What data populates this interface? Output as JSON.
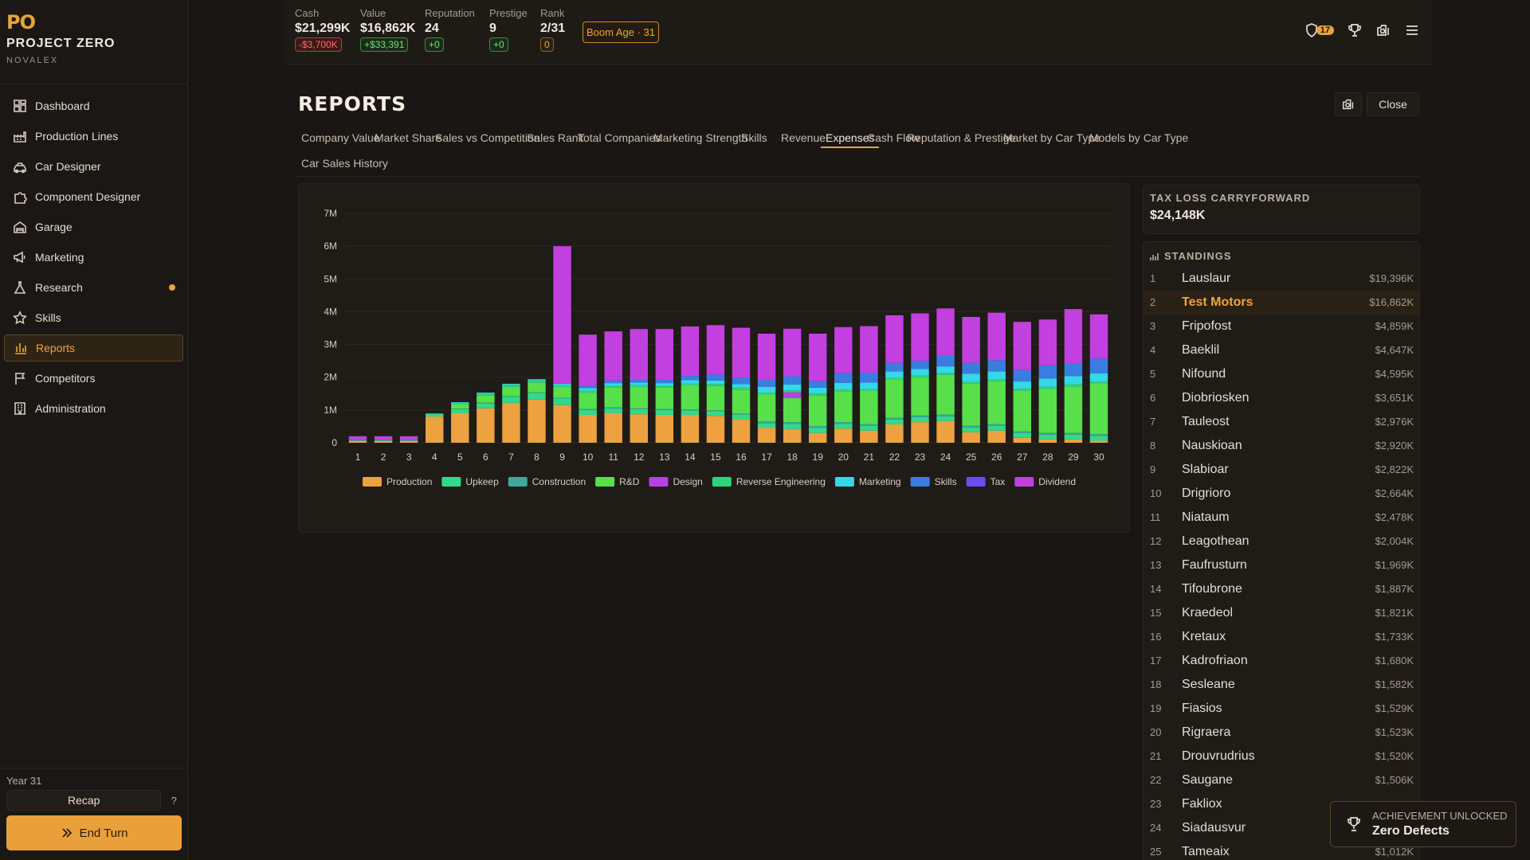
{
  "app": {
    "logo": "PO",
    "name": "PROJECT ZERO",
    "company": "NOVALEX"
  },
  "nav": [
    {
      "label": "Dashboard",
      "icon": "dashboard-icon"
    },
    {
      "label": "Production Lines",
      "icon": "factory-icon"
    },
    {
      "label": "Car Designer",
      "icon": "car-icon"
    },
    {
      "label": "Component Designer",
      "icon": "puzzle-icon"
    },
    {
      "label": "Garage",
      "icon": "garage-icon"
    },
    {
      "label": "Marketing",
      "icon": "megaphone-icon"
    },
    {
      "label": "Research",
      "icon": "flask-icon",
      "dot": true
    },
    {
      "label": "Skills",
      "icon": "star-icon"
    },
    {
      "label": "Reports",
      "icon": "bar-chart-icon",
      "active": true
    },
    {
      "label": "Competitors",
      "icon": "flag-icon"
    },
    {
      "label": "Administration",
      "icon": "building-icon"
    }
  ],
  "footer": {
    "year": "Year 31",
    "recap": "Recap",
    "help": "?",
    "end_turn": "End Turn"
  },
  "stats": {
    "cash": {
      "label": "Cash",
      "value": "$21,299K",
      "delta": "-$3,700K"
    },
    "value": {
      "label": "Value",
      "value": "$16,862K",
      "delta": "+$33,391"
    },
    "reputation": {
      "label": "Reputation",
      "value": "24",
      "delta": "+0"
    },
    "prestige": {
      "label": "Prestige",
      "value": "9",
      "delta": "+0"
    },
    "rank": {
      "label": "Rank",
      "value": "2/31",
      "delta": "0"
    },
    "boom": "Boom Age · 31",
    "notifications": "17"
  },
  "page": {
    "title": "REPORTS",
    "close": "Close"
  },
  "tabs": [
    "Company Value",
    "Market Share",
    "Sales vs Competition",
    "Sales Rank",
    "Total Companies",
    "Marketing Strength",
    "Skills",
    "Revenue",
    "Expenses",
    "Cash Flow",
    "Reputation & Prestige",
    "Market by Car Type",
    "Models by Car Type",
    "Car Sales History"
  ],
  "active_tab": "Expenses",
  "tax": {
    "label": "TAX LOSS CARRYFORWARD",
    "value": "$24,148K"
  },
  "standings": {
    "title": "STANDINGS",
    "rows": [
      {
        "rank": "1",
        "name": "Lauslaur",
        "value": "$19,396K"
      },
      {
        "rank": "2",
        "name": "Test Motors",
        "value": "$16,862K",
        "highlight": true
      },
      {
        "rank": "3",
        "name": "Fripofost",
        "value": "$4,859K"
      },
      {
        "rank": "4",
        "name": "Baeklil",
        "value": "$4,647K"
      },
      {
        "rank": "5",
        "name": "Nifound",
        "value": "$4,595K"
      },
      {
        "rank": "6",
        "name": "Diobriosken",
        "value": "$3,651K"
      },
      {
        "rank": "7",
        "name": "Tauleost",
        "value": "$2,976K"
      },
      {
        "rank": "8",
        "name": "Nauskioan",
        "value": "$2,920K"
      },
      {
        "rank": "9",
        "name": "Slabioar",
        "value": "$2,822K"
      },
      {
        "rank": "10",
        "name": "Drigrioro",
        "value": "$2,664K"
      },
      {
        "rank": "11",
        "name": "Niataum",
        "value": "$2,478K"
      },
      {
        "rank": "12",
        "name": "Leagothean",
        "value": "$2,004K"
      },
      {
        "rank": "13",
        "name": "Faufrusturn",
        "value": "$1,969K"
      },
      {
        "rank": "14",
        "name": "Tifoubrone",
        "value": "$1,887K"
      },
      {
        "rank": "15",
        "name": "Kraedeol",
        "value": "$1,821K"
      },
      {
        "rank": "16",
        "name": "Kretaux",
        "value": "$1,733K"
      },
      {
        "rank": "17",
        "name": "Kadrofriaon",
        "value": "$1,680K"
      },
      {
        "rank": "18",
        "name": "Sesleane",
        "value": "$1,582K"
      },
      {
        "rank": "19",
        "name": "Fiasios",
        "value": "$1,529K"
      },
      {
        "rank": "20",
        "name": "Rigraera",
        "value": "$1,523K"
      },
      {
        "rank": "21",
        "name": "Drouvrudrius",
        "value": "$1,520K"
      },
      {
        "rank": "22",
        "name": "Saugane",
        "value": "$1,506K"
      },
      {
        "rank": "23",
        "name": "Fakliox",
        "value": ""
      },
      {
        "rank": "24",
        "name": "Siadausvur",
        "value": ""
      },
      {
        "rank": "25",
        "name": "Tameaix",
        "value": "$1,012K"
      }
    ]
  },
  "toast": {
    "title": "ACHIEVEMENT UNLOCKED",
    "text": "Zero Defects"
  },
  "chart_data": {
    "type": "bar",
    "stacked": true,
    "ylim": [
      0,
      7000000
    ],
    "yticks": [
      "0",
      "1M",
      "2M",
      "3M",
      "4M",
      "5M",
      "6M",
      "7M"
    ],
    "ytick_values": [
      0,
      1000000,
      2000000,
      3000000,
      4000000,
      5000000,
      6000000,
      7000000
    ],
    "categories": [
      "1",
      "2",
      "3",
      "4",
      "5",
      "6",
      "7",
      "8",
      "9",
      "10",
      "11",
      "12",
      "13",
      "14",
      "15",
      "16",
      "17",
      "18",
      "19",
      "20",
      "21",
      "22",
      "23",
      "24",
      "25",
      "26",
      "27",
      "28",
      "29",
      "30"
    ],
    "legend_position": "bottom",
    "grid": true,
    "series": [
      {
        "name": "Production",
        "color": "#eda140",
        "values": [
          50000,
          50000,
          50000,
          800000,
          900000,
          1050000,
          1220000,
          1320000,
          1150000,
          850000,
          900000,
          870000,
          850000,
          850000,
          820000,
          720000,
          450000,
          420000,
          300000,
          430000,
          370000,
          560000,
          630000,
          660000,
          320000,
          370000,
          150000,
          100000,
          100000,
          60000
        ]
      },
      {
        "name": "Upkeep",
        "color": "#33d98a",
        "values": [
          20000,
          20000,
          20000,
          80000,
          120000,
          150000,
          180000,
          200000,
          200000,
          150000,
          150000,
          150000,
          150000,
          140000,
          140000,
          140000,
          150000,
          150000,
          150000,
          150000,
          150000,
          150000,
          150000,
          150000,
          150000,
          150000,
          150000,
          150000,
          150000,
          150000
        ]
      },
      {
        "name": "Construction",
        "color": "#3aa89a",
        "values": [
          10000,
          10000,
          10000,
          20000,
          20000,
          20000,
          20000,
          20000,
          20000,
          30000,
          30000,
          30000,
          30000,
          30000,
          30000,
          30000,
          50000,
          60000,
          60000,
          50000,
          50000,
          50000,
          50000,
          50000,
          50000,
          50000,
          50000,
          50000,
          50000,
          50000
        ]
      },
      {
        "name": "R&D",
        "color": "#57e04a",
        "values": [
          0,
          0,
          0,
          0,
          140000,
          220000,
          290000,
          300000,
          330000,
          500000,
          600000,
          650000,
          650000,
          730000,
          740000,
          730000,
          820000,
          730000,
          930000,
          940000,
          1010000,
          1160000,
          1160000,
          1210000,
          1280000,
          1300000,
          1240000,
          1350000,
          1420000,
          1550000
        ]
      },
      {
        "name": "Design",
        "color": "#b840e6",
        "values": [
          0,
          0,
          0,
          0,
          0,
          0,
          0,
          0,
          0,
          0,
          0,
          0,
          0,
          0,
          0,
          0,
          0,
          180000,
          0,
          0,
          0,
          0,
          0,
          0,
          0,
          0,
          0,
          0,
          0,
          0
        ]
      },
      {
        "name": "Reverse Engineering",
        "color": "#2fd37a",
        "values": [
          0,
          0,
          0,
          0,
          40000,
          60000,
          60000,
          60000,
          60000,
          60000,
          60000,
          60000,
          60000,
          60000,
          60000,
          60000,
          60000,
          60000,
          60000,
          60000,
          60000,
          60000,
          60000,
          60000,
          60000,
          60000,
          60000,
          60000,
          60000,
          60000
        ]
      },
      {
        "name": "Marketing",
        "color": "#34d8e8",
        "values": [
          0,
          0,
          0,
          0,
          20000,
          30000,
          30000,
          40000,
          40000,
          80000,
          80000,
          80000,
          80000,
          100000,
          110000,
          110000,
          180000,
          180000,
          180000,
          200000,
          200000,
          200000,
          200000,
          200000,
          250000,
          250000,
          220000,
          250000,
          250000,
          250000
        ]
      },
      {
        "name": "Skills",
        "color": "#3a7de0",
        "values": [
          0,
          0,
          0,
          0,
          0,
          0,
          0,
          0,
          0,
          80000,
          80000,
          80000,
          100000,
          130000,
          180000,
          200000,
          200000,
          250000,
          200000,
          300000,
          300000,
          260000,
          250000,
          320000,
          330000,
          340000,
          350000,
          400000,
          400000,
          450000
        ]
      },
      {
        "name": "Tax",
        "color": "#6a4cf0",
        "values": [
          0,
          0,
          0,
          0,
          0,
          0,
          0,
          0,
          0,
          0,
          0,
          0,
          0,
          0,
          0,
          0,
          0,
          0,
          0,
          0,
          0,
          0,
          0,
          0,
          0,
          0,
          0,
          0,
          0,
          0
        ]
      },
      {
        "name": "Dividend",
        "color": "#c23fe0",
        "values": [
          120000,
          120000,
          120000,
          0,
          0,
          0,
          0,
          0,
          4200000,
          1550000,
          1500000,
          1550000,
          1550000,
          1510000,
          1510000,
          1520000,
          1420000,
          1450000,
          1450000,
          1400000,
          1420000,
          1450000,
          1450000,
          1450000,
          1400000,
          1450000,
          1470000,
          1400000,
          1650000,
          1350000
        ]
      }
    ]
  }
}
